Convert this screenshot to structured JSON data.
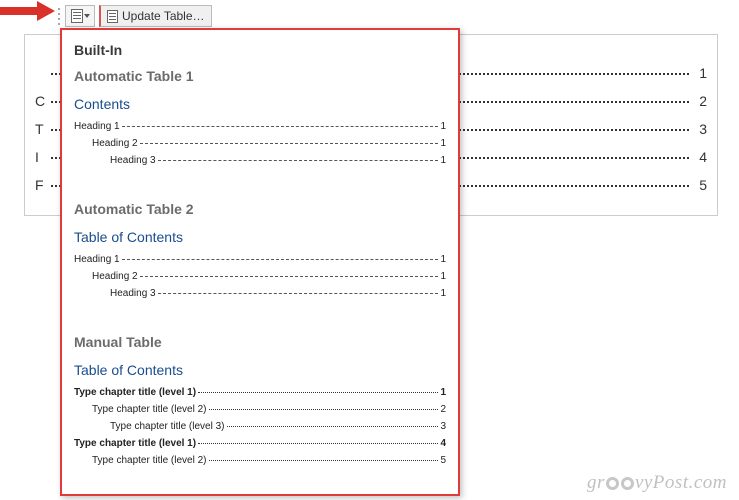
{
  "toolbar": {
    "update_label": "Update Table…"
  },
  "bg_toc": {
    "rows": [
      {
        "label": "",
        "page": "1"
      },
      {
        "label": "C",
        "page": "2"
      },
      {
        "label": "T",
        "page": "3"
      },
      {
        "label": "I",
        "page": "4"
      },
      {
        "label": "F",
        "page": "5"
      }
    ]
  },
  "gallery": {
    "section": "Built-In",
    "options": [
      {
        "title": "Automatic Table 1",
        "subtitle": "Contents",
        "rows": [
          {
            "label": "Heading 1",
            "page": "1",
            "indent": 0,
            "bold": false
          },
          {
            "label": "Heading 2",
            "page": "1",
            "indent": 1,
            "bold": false
          },
          {
            "label": "Heading 3",
            "page": "1",
            "indent": 2,
            "bold": false
          }
        ],
        "dotstyle": "dash"
      },
      {
        "title": "Automatic Table 2",
        "subtitle": "Table of Contents",
        "rows": [
          {
            "label": "Heading 1",
            "page": "1",
            "indent": 0,
            "bold": false
          },
          {
            "label": "Heading 2",
            "page": "1",
            "indent": 1,
            "bold": false
          },
          {
            "label": "Heading 3",
            "page": "1",
            "indent": 2,
            "bold": false
          }
        ],
        "dotstyle": "dash"
      },
      {
        "title": "Manual Table",
        "subtitle": "Table of Contents",
        "rows": [
          {
            "label": "Type chapter title (level 1)",
            "page": "1",
            "indent": 0,
            "bold": true
          },
          {
            "label": "Type chapter title (level 2)",
            "page": "2",
            "indent": 1,
            "bold": false
          },
          {
            "label": "Type chapter title (level 3)",
            "page": "3",
            "indent": 2,
            "bold": false
          },
          {
            "label": "Type chapter title (level 1)",
            "page": "4",
            "indent": 0,
            "bold": true
          },
          {
            "label": "Type chapter title (level 2)",
            "page": "5",
            "indent": 1,
            "bold": false
          }
        ],
        "dotstyle": "dot"
      }
    ]
  },
  "watermark": "groovyPost.com"
}
